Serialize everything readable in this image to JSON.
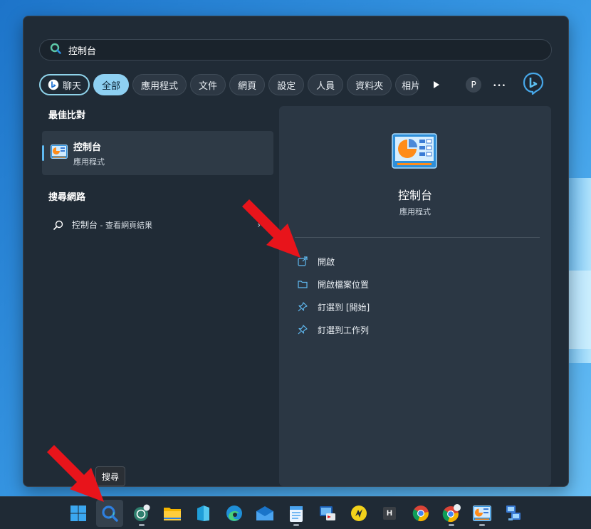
{
  "search": {
    "value": "控制台"
  },
  "tabs": {
    "chat": "聊天",
    "items": [
      "全部",
      "應用程式",
      "文件",
      "網頁",
      "設定",
      "人員",
      "資料夾"
    ],
    "cut": "相片",
    "profile": "P",
    "more": "•••"
  },
  "best_match": {
    "title": "最佳比對",
    "name": "控制台",
    "type": "應用程式"
  },
  "web": {
    "title": "搜尋網路",
    "query": "控制台",
    "suffix": " - 查看網頁結果"
  },
  "detail": {
    "name": "控制台",
    "type": "應用程式",
    "actions": [
      "開啟",
      "開啟檔案位置",
      "釘選到 [開始]",
      "釘選到工作列"
    ]
  },
  "taskbar": {
    "tooltip": "搜尋"
  },
  "colors": {
    "accent": "#8ed0f2",
    "arrow": "#e8141b"
  }
}
